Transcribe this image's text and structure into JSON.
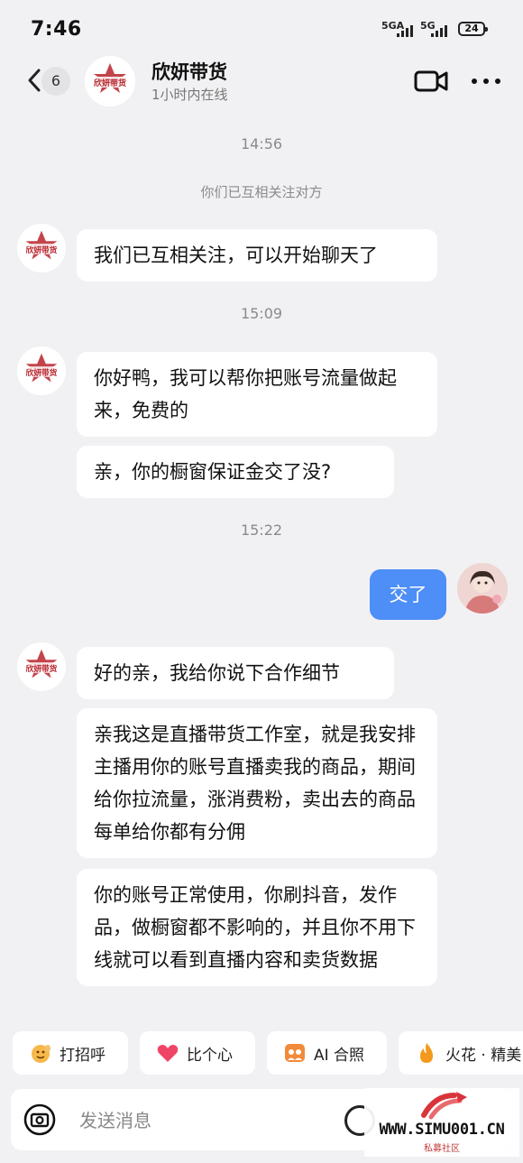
{
  "status_bar": {
    "time": "7:46",
    "sim1": "5GA",
    "sim2": "5G",
    "battery": "24"
  },
  "header": {
    "unread_count": "6",
    "contact_name": "欣妍带货",
    "contact_status": "1小时内在线",
    "avatar_logo_text": "欣妍带货"
  },
  "chat": {
    "timestamps": [
      "14:56",
      "15:09",
      "15:22"
    ],
    "system_message": "你们已互相关注对方",
    "messages": [
      {
        "text": "我们已互相关注，可以开始聊天了"
      },
      {
        "text": "你好鸭，我可以帮你把账号流量做起来，免费的"
      },
      {
        "text": "亲，你的橱窗保证金交了没?"
      },
      {
        "text": "交了"
      },
      {
        "text": "好的亲，我给你说下合作细节"
      },
      {
        "text": "亲我这是直播带货工作室，就是我安排主播用你的账号直播卖我的商品，期间给你拉流量，涨消费粉，卖出去的商品每单给你都有分佣"
      },
      {
        "text": "你的账号正常使用，你刷抖音，发作品，做橱窗都不影响的，并且你不用下线就可以看到直播内容和卖货数据"
      }
    ]
  },
  "quick_replies": [
    {
      "label": "打招呼",
      "icon": "wave-emoji-icon"
    },
    {
      "label": "比个心",
      "icon": "heart-icon"
    },
    {
      "label": "AI 合照",
      "icon": "photo-icon"
    },
    {
      "label": "火花 · 精美",
      "icon": "flame-icon"
    }
  ],
  "input": {
    "placeholder": "发送消息"
  },
  "watermark": {
    "text": "WWW.SIMU001.CN",
    "subtext": "私募社区"
  },
  "colors": {
    "background": "#f1f1f3",
    "my_bubble": "#4d8ef7",
    "logo_red": "#b8232b"
  }
}
